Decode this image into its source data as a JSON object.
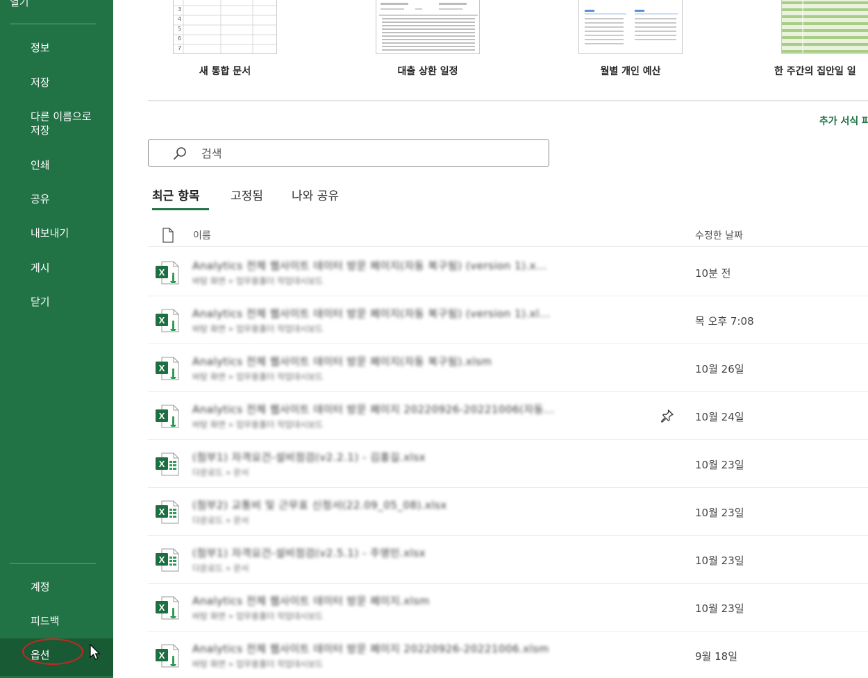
{
  "sidebar": {
    "top_partial_label": "열기",
    "items": [
      {
        "label": "정보"
      },
      {
        "label": "저장"
      },
      {
        "label": "다른 이름으로 저장"
      },
      {
        "label": "인쇄"
      },
      {
        "label": "공유"
      },
      {
        "label": "내보내기"
      },
      {
        "label": "게시"
      },
      {
        "label": "닫기"
      }
    ],
    "bottom_items": [
      {
        "label": "계정"
      },
      {
        "label": "피드백"
      },
      {
        "label": "옵션"
      }
    ],
    "bg_color": "#217346",
    "highlight_circle_color": "#d62020"
  },
  "templates": [
    {
      "label": "새 통합 문서",
      "row_numbers": [
        "3",
        "4",
        "5",
        "6",
        "7"
      ]
    },
    {
      "label": "대출 상환 일정"
    },
    {
      "label": "월별 개인 예산"
    },
    {
      "label": "한 주간의 집안일 일"
    }
  ],
  "more_templates_label": "추가 서식 파",
  "search": {
    "placeholder": "검색"
  },
  "tabs": [
    {
      "label": "최근 항목",
      "active": true
    },
    {
      "label": "고정됨",
      "active": false
    },
    {
      "label": "나와 공유",
      "active": false
    }
  ],
  "list_header": {
    "name": "이름",
    "date": "수정한 날짜"
  },
  "files": [
    {
      "name": "Analytics 전체 웹사이트 데이터 방문 페이지(자동 복구됨) (version 1).x...",
      "path": "바탕 화면 » 업무용폴더 작업대시보드",
      "date": "10분 전",
      "icon": "excel-macro-icon",
      "pinned": false
    },
    {
      "name": "Analytics 전체 웹사이트 데이터 방문 페이지(자동 복구됨) (version 1).xl...",
      "path": "바탕 화면 » 업무용폴더 작업대시보드",
      "date": "목 오후 7:08",
      "icon": "excel-macro-icon",
      "pinned": false
    },
    {
      "name": "Analytics 전체 웹사이트 데이터 방문 페이지(자동 복구됨).xlsm",
      "path": "바탕 화면 » 업무용폴더 작업대시보드",
      "date": "10월 26일",
      "icon": "excel-macro-icon",
      "pinned": false
    },
    {
      "name": "Analytics 전체 웹사이트 데이터 방문 페이지 20220926-20221006(자동...",
      "path": "바탕 화면 » 업무용폴더 작업대시보드",
      "date": "10월 24일",
      "icon": "excel-macro-icon",
      "pinned": true
    },
    {
      "name": "(첨부1) 자격요건-설비점검(v2.2.1) - 김홍길.xlsx",
      "path": "다운로드 » 문서",
      "date": "10월 23일",
      "icon": "excel-workbook-icon",
      "pinned": false
    },
    {
      "name": "(첨부2) 교통비 및 근무표 신청서(22.09_05_08).xlsx",
      "path": "다운로드 » 문서",
      "date": "10월 23일",
      "icon": "excel-workbook-icon",
      "pinned": false
    },
    {
      "name": "(첨부1) 자격요건-설비점검(v2.5.1) - 주영민.xlsx",
      "path": "다운로드 » 문서",
      "date": "10월 23일",
      "icon": "excel-workbook-icon",
      "pinned": false
    },
    {
      "name": "Analytics 전체 웹사이트 데이터 방문 페이지.xlsm",
      "path": "바탕 화면 » 업무용폴더 작업대시보드",
      "date": "10월 23일",
      "icon": "excel-macro-icon",
      "pinned": false
    },
    {
      "name": "Analytics 전체 웹사이트 데이터 방문 페이지 20220926-20221006.xlsm",
      "path": "바탕 화면 » 업무용폴더 작업대시보드",
      "date": "9월 18일",
      "icon": "excel-macro-icon",
      "pinned": false
    }
  ]
}
